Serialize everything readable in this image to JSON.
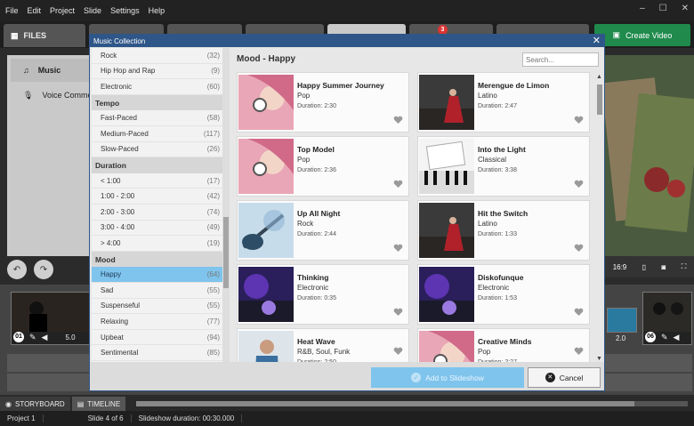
{
  "menu": [
    "File",
    "Edit",
    "Project",
    "Slide",
    "Settings",
    "Help"
  ],
  "app_tabs": {
    "files": "FILES",
    "badge": "3"
  },
  "create_label": "Create Video",
  "left_panel": {
    "music": "Music",
    "voice": "Voice Comme"
  },
  "dialog": {
    "title": "Music Collection",
    "heading": "Mood - Happy",
    "search_placeholder": "Search...",
    "add_label": "Add to Slideshow",
    "cancel_label": "Cancel"
  },
  "categories": [
    {
      "type": "item",
      "label": "Rock",
      "count": "(32)"
    },
    {
      "type": "item",
      "label": "Hip Hop and Rap",
      "count": "(9)"
    },
    {
      "type": "item",
      "label": "Electronic",
      "count": "(60)"
    },
    {
      "type": "head",
      "label": "Tempo"
    },
    {
      "type": "item",
      "label": "Fast-Paced",
      "count": "(58)"
    },
    {
      "type": "item",
      "label": "Medium-Paced",
      "count": "(117)"
    },
    {
      "type": "item",
      "label": "Slow-Paced",
      "count": "(26)"
    },
    {
      "type": "head",
      "label": "Duration"
    },
    {
      "type": "item",
      "label": "< 1:00",
      "count": "(17)"
    },
    {
      "type": "item",
      "label": "1:00 - 2:00",
      "count": "(42)"
    },
    {
      "type": "item",
      "label": "2:00 - 3:00",
      "count": "(74)"
    },
    {
      "type": "item",
      "label": "3:00 - 4:00",
      "count": "(49)"
    },
    {
      "type": "item",
      "label": "> 4:00",
      "count": "(19)"
    },
    {
      "type": "head",
      "label": "Mood"
    },
    {
      "type": "item",
      "label": "Happy",
      "count": "(64)",
      "selected": true
    },
    {
      "type": "item",
      "label": "Sad",
      "count": "(55)"
    },
    {
      "type": "item",
      "label": "Suspenseful",
      "count": "(55)"
    },
    {
      "type": "item",
      "label": "Relaxing",
      "count": "(77)"
    },
    {
      "type": "item",
      "label": "Upbeat",
      "count": "(94)"
    },
    {
      "type": "item",
      "label": "Sentimental",
      "count": "(85)"
    }
  ],
  "tracks": [
    {
      "title": "Happy Summer Journey",
      "genre": "Pop",
      "duration": "Duration: 2:30",
      "art": "pink-headphones"
    },
    {
      "title": "Merengue de Limon",
      "genre": "Latino",
      "duration": "Duration: 2:47",
      "art": "dancer"
    },
    {
      "title": "Top Model",
      "genre": "Pop",
      "duration": "Duration: 2:36",
      "art": "pink-headphones"
    },
    {
      "title": "Into the Light",
      "genre": "Classical",
      "duration": "Duration: 3:38",
      "art": "piano"
    },
    {
      "title": "Up All Night",
      "genre": "Rock",
      "duration": "Duration: 2:44",
      "art": "guitar"
    },
    {
      "title": "Hit the Switch",
      "genre": "Latino",
      "duration": "Duration: 1:33",
      "art": "dancer"
    },
    {
      "title": "Thinking",
      "genre": "Electronic",
      "duration": "Duration: 0:35",
      "art": "dj"
    },
    {
      "title": "Diskofunque",
      "genre": "Electronic",
      "duration": "Duration: 1:53",
      "art": "dj"
    },
    {
      "title": "Heat Wave",
      "genre": "R&B, Soul, Funk",
      "duration": "Duration: 2:50",
      "art": "woman"
    },
    {
      "title": "Creative Minds",
      "genre": "Pop",
      "duration": "Duration: 2:27",
      "art": "pink-headphones"
    }
  ],
  "timeline": {
    "slide1_num": "01",
    "slide1_dur": "5.0",
    "slide6_num": "06",
    "slide_mid_dur": "2.0"
  },
  "preview": {
    "ratio": "16:9"
  },
  "view_tabs": {
    "storyboard": "STORYBOARD",
    "timeline": "TIMELINE"
  },
  "status": {
    "project": "Project 1",
    "slide": "Slide 4 of 6",
    "duration": "Slideshow duration: 00:30.000"
  },
  "colors": {
    "accent": "#7fc4ec",
    "dialog_title": "#2f5688",
    "create": "#1f8a4c"
  }
}
